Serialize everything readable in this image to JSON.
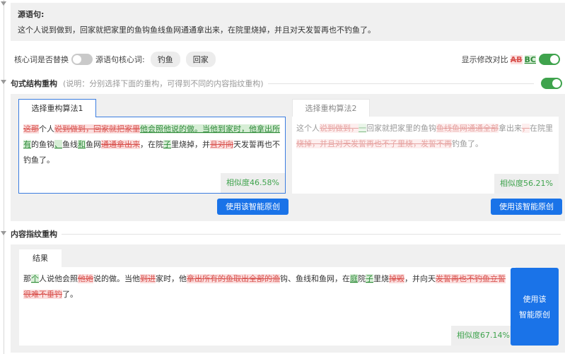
{
  "source": {
    "title": "源语句:",
    "text": "这个人说到做到，回家就把家里的鱼钩鱼线鱼网通通拿出来，在院里烧掉，并且对天发誓再也不钓鱼了。"
  },
  "controls": {
    "keyword_replace_label": "核心词是否替换",
    "keyword_replace_on": false,
    "source_keywords_label": "源语句核心词:",
    "keywords": [
      "钓鱼",
      "回家"
    ],
    "show_diff_label": "显示修改对比",
    "diff_demo_deleted": "AB",
    "diff_demo_inserted": "BC",
    "show_diff_on": true
  },
  "structure_section": {
    "title": "句式结构重构",
    "note": "(说明：分别选择下面的重构，可得到不同的内容指纹重构)",
    "enabled": true,
    "tab1": "选择重构算法1",
    "tab2": "选择重构算法2",
    "result1": [
      {
        "t": "这那",
        "s": "del"
      },
      {
        "t": "个人"
      },
      {
        "t": "说到做到，回家就把家里",
        "s": "del"
      },
      {
        "t": "他会照他说的做。当他到家时，他拿出所有",
        "s": "ins"
      },
      {
        "t": "的鱼钩"
      },
      {
        "t": "、",
        "s": "ins"
      },
      {
        "t": "鱼线"
      },
      {
        "t": "和",
        "s": "ins"
      },
      {
        "t": "鱼网"
      },
      {
        "t": "通通拿出来",
        "s": "del"
      },
      {
        "t": "，在院"
      },
      {
        "t": "子",
        "s": "ins"
      },
      {
        "t": "里烧掉，并"
      },
      {
        "t": "且对向",
        "s": "del"
      },
      {
        "t": "天发誓再也不钓鱼了。"
      }
    ],
    "result2": [
      {
        "t": "这个人"
      },
      {
        "t": "说到做到，",
        "s": "del"
      },
      {
        "t": "一",
        "s": "ins"
      },
      {
        "t": "回家就把家里的鱼钩"
      },
      {
        "t": "鱼线鱼网通通全部",
        "s": "del"
      },
      {
        "t": "拿出来"
      },
      {
        "t": "，",
        "s": "del"
      },
      {
        "t": "在院里"
      },
      {
        "t": "烧掉，并且对天发誓再也不子里烧，发誓不再",
        "s": "del"
      },
      {
        "t": "钓鱼了。"
      }
    ],
    "similarity1": "相似度46.58%",
    "similarity2": "相似度56.21%",
    "use_button1": "使用该智能原创",
    "use_button2": "使用该智能原创"
  },
  "fingerprint_section": {
    "title": "内容指纹重构",
    "tab": "结果",
    "result": [
      {
        "t": "那"
      },
      {
        "t": "个",
        "s": "ins"
      },
      {
        "t": "人说他会照"
      },
      {
        "t": "他她",
        "s": "del"
      },
      {
        "t": "说的做。当他"
      },
      {
        "t": "到进",
        "s": "del"
      },
      {
        "t": "家时，他"
      },
      {
        "t": "拿出所有的鱼取出全部的渔",
        "s": "del"
      },
      {
        "t": "钩、鱼线和鱼网，在"
      },
      {
        "t": "庭",
        "s": "ins"
      },
      {
        "t": "院"
      },
      {
        "t": "子",
        "s": "ins"
      },
      {
        "t": "里烧"
      },
      {
        "t": "掉毁",
        "s": "del"
      },
      {
        "t": "，并向天"
      },
      {
        "t": "发誓再也不钓鱼立誓很难不垂钓",
        "s": "del"
      },
      {
        "t": "了。"
      }
    ],
    "similarity": "相似度67.14%",
    "use_button_line1": "使用该",
    "use_button_line2": "智能原创"
  }
}
